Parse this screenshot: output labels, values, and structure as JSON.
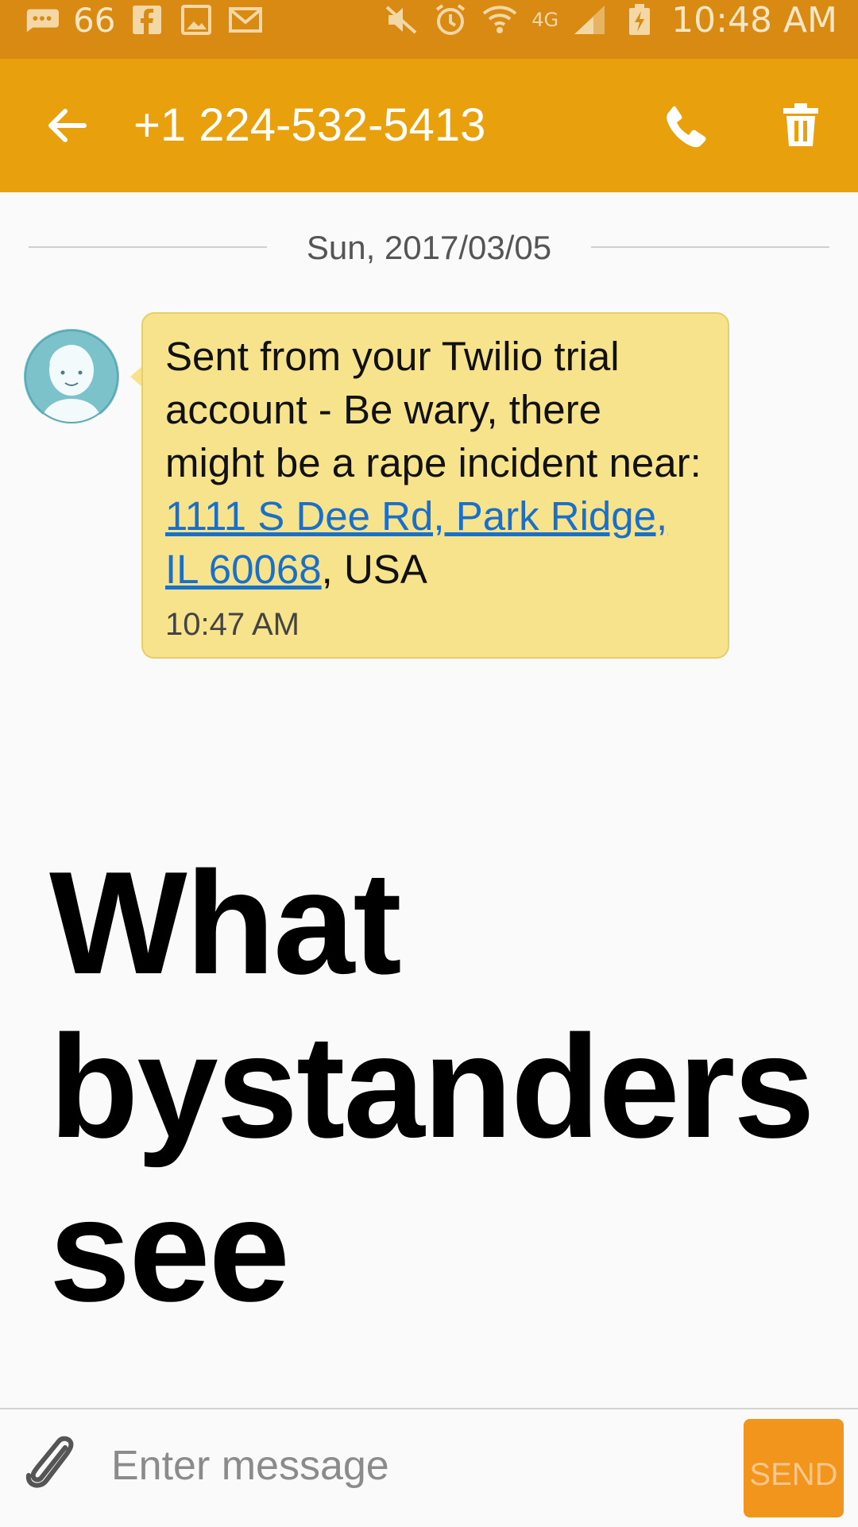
{
  "status_bar": {
    "notification_count": "66",
    "time": "10:48 AM",
    "network_label": "4G",
    "icons": [
      "message-icon",
      "facebook-icon",
      "gallery-icon",
      "email-icon",
      "mute-icon",
      "alarm-icon",
      "wifi-icon",
      "signal-icon",
      "battery-charging-icon"
    ]
  },
  "app_bar": {
    "title": "+1 224-532-5413",
    "back_icon": "arrow-back-icon",
    "call_icon": "phone-icon",
    "delete_icon": "trash-icon",
    "colors": {
      "status_bar": "#d98a12",
      "app_bar": "#e8a00c"
    }
  },
  "conversation": {
    "date": "Sun, 2017/03/05",
    "messages": [
      {
        "text_before_link": "Sent from your Twilio trial account - Be wary, there might be a rape incident near: ",
        "link_text": "1111 S Dee Rd, Park Ridge, IL 60068",
        "text_after_link": ", USA",
        "time": "10:47 AM",
        "bubble_color": "#f6e38b"
      }
    ]
  },
  "overlay": {
    "headline": "What bystanders see"
  },
  "composer": {
    "placeholder": "Enter message",
    "send_label": "SEND",
    "attach_icon": "paperclip-icon",
    "send_color": "#f2951c"
  }
}
